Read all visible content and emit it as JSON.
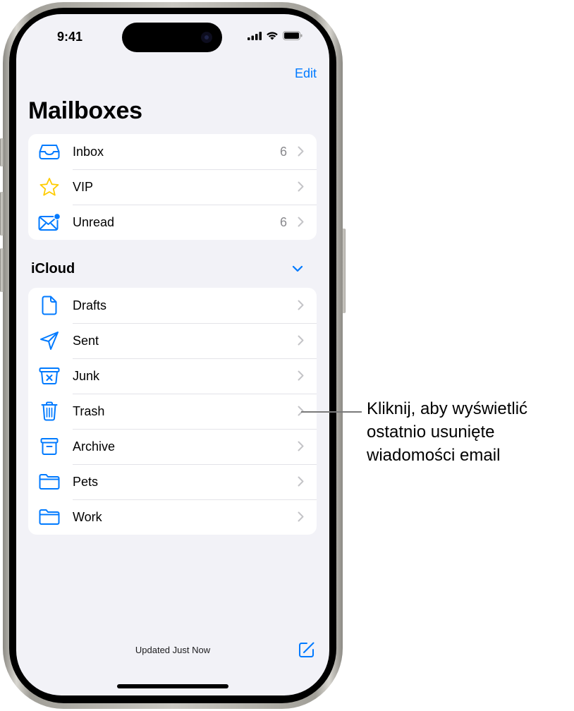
{
  "status_bar": {
    "time": "9:41",
    "icons": [
      "cellular-signal-icon",
      "wifi-icon",
      "battery-icon"
    ]
  },
  "nav": {
    "edit_label": "Edit",
    "title": "Mailboxes"
  },
  "favorites": [
    {
      "label": "Inbox",
      "count": "6",
      "icon": "inbox-tray-icon"
    },
    {
      "label": "VIP",
      "count": "",
      "icon": "star-icon"
    },
    {
      "label": "Unread",
      "count": "6",
      "icon": "unread-envelope-icon"
    }
  ],
  "icloud": {
    "header": "iCloud",
    "items": [
      {
        "label": "Drafts",
        "icon": "document-icon"
      },
      {
        "label": "Sent",
        "icon": "paper-plane-icon"
      },
      {
        "label": "Junk",
        "icon": "junk-bin-icon"
      },
      {
        "label": "Trash",
        "icon": "trash-icon"
      },
      {
        "label": "Archive",
        "icon": "archive-box-icon"
      },
      {
        "label": "Pets",
        "icon": "folder-icon"
      },
      {
        "label": "Work",
        "icon": "folder-icon"
      }
    ]
  },
  "footer": {
    "status": "Updated Just Now"
  },
  "callout": {
    "lines": [
      "Kliknij, aby wyświetlić",
      "ostatnio usunięte",
      "wiadomości email"
    ],
    "target": "Trash"
  },
  "colors": {
    "accent": "#007aff",
    "star": "#ffcc00",
    "background": "#f2f2f7",
    "chevron": "#c4c4c7",
    "count": "#8a8a8e"
  }
}
